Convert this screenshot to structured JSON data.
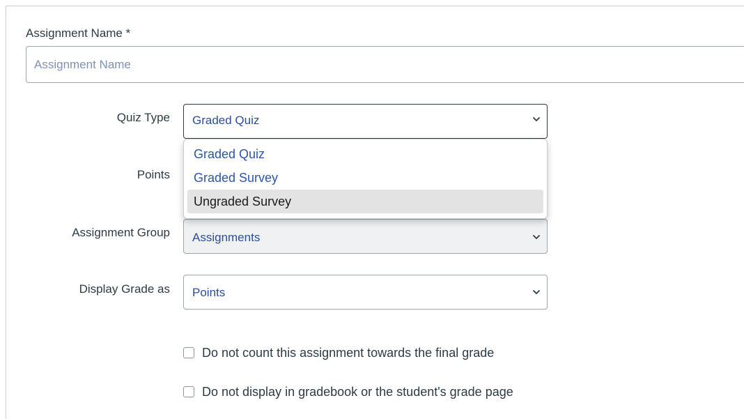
{
  "assignment_name": {
    "label": "Assignment Name *",
    "placeholder": "Assignment Name",
    "value": ""
  },
  "quiz_type": {
    "label": "Quiz Type",
    "selected": "Graded Quiz",
    "options": [
      "Graded Quiz",
      "Graded Survey",
      "Ungraded Survey"
    ],
    "highlighted": "Ungraded Survey"
  },
  "points": {
    "label": "Points"
  },
  "assignment_group": {
    "label": "Assignment Group",
    "selected": "Assignments"
  },
  "display_grade": {
    "label": "Display Grade as",
    "selected": "Points"
  },
  "checkboxes": [
    {
      "label": "Do not count this assignment towards the final grade",
      "checked": false
    },
    {
      "label": "Do not display in gradebook or the student's grade page",
      "checked": false
    }
  ],
  "colors": {
    "link_blue": "#2b55b0",
    "value_blue": "#2b4d9a",
    "text": "#2d3b45",
    "highlight": "#e3e3e3"
  },
  "icons": {
    "select_arrow": "chevron-down-icon"
  }
}
